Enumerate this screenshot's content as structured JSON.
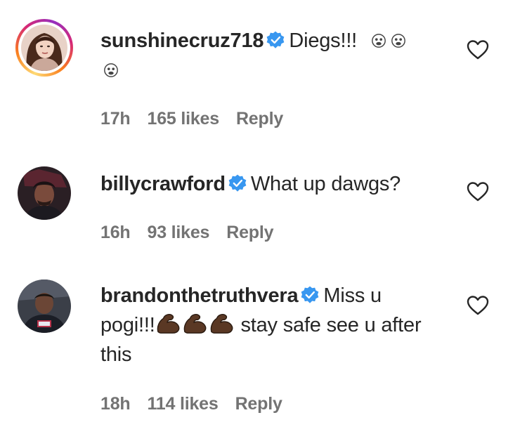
{
  "comments": [
    {
      "username": "sunshinecruz718",
      "text": "Diegs!!!",
      "emoji": "😨",
      "time": "17h",
      "likes": "165 likes",
      "reply": "Reply",
      "avatar_icon": "woman-portrait"
    },
    {
      "username": "billycrawford",
      "text": "What up dawgs?",
      "time": "16h",
      "likes": "93 likes",
      "reply": "Reply",
      "avatar_icon": "man-portrait-dark"
    },
    {
      "username": "brandonthetruthvera",
      "text_before": "Miss u pogi!!!",
      "emoji": "💪🏿",
      "text_after": " stay safe see u after this",
      "time": "18h",
      "likes": "114 likes",
      "reply": "Reply",
      "avatar_icon": "man-portrait"
    }
  ],
  "colors": {
    "verified": "#3897f0",
    "meta": "#737373",
    "text": "#262626"
  },
  "icons": {
    "verified": "verified-badge-icon",
    "like": "heart-outline-icon"
  }
}
